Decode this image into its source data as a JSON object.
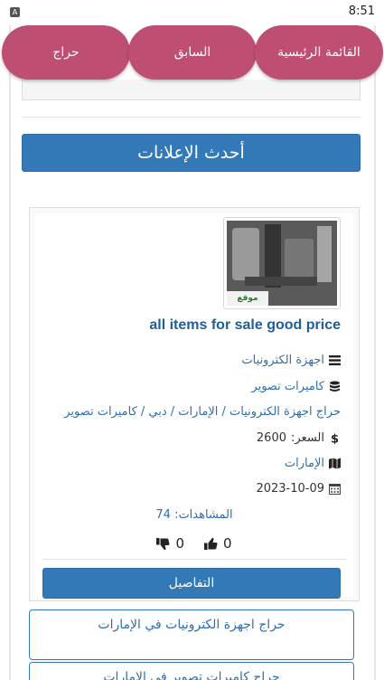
{
  "status_bar": {
    "app_glyph": "A",
    "time": "8:51"
  },
  "nav": {
    "home": "القائمة الرئيسية",
    "back": "السابق",
    "haraj": "حراج"
  },
  "section_title": "أحدث الإعلانات",
  "ad": {
    "image_watermark": "موقع حراج",
    "title": "all items for sale good price",
    "category": "اجهزة الكترونيات",
    "subcategory": "كاميرات تصوير",
    "breadcrumb": "حراج اجهزة الكترونيات / الإمارات / دبي / كاميرات تصوير",
    "price_label": "السعر:",
    "price_value": "2600",
    "location": "الإمارات",
    "date": "2023-10-09",
    "views_label": "المشاهدات:",
    "views_value": "74",
    "likes": "0",
    "dislikes": "0",
    "details_button": "التفاصيل"
  },
  "related_links": [
    {
      "label": "حراج اجهزة الكترونيات في الإمارات"
    },
    {
      "label": "حراج كاميرات تصوير في الإمارات"
    }
  ],
  "colors": {
    "nav_pill": "#bf4e73",
    "primary": "#3379b7",
    "link": "#2f6fae",
    "title": "#1f5f97"
  },
  "icons": [
    "list-icon",
    "database-icon",
    "dollar-icon",
    "map-icon",
    "calendar-icon",
    "thumbs-up-icon",
    "thumbs-down-icon"
  ]
}
